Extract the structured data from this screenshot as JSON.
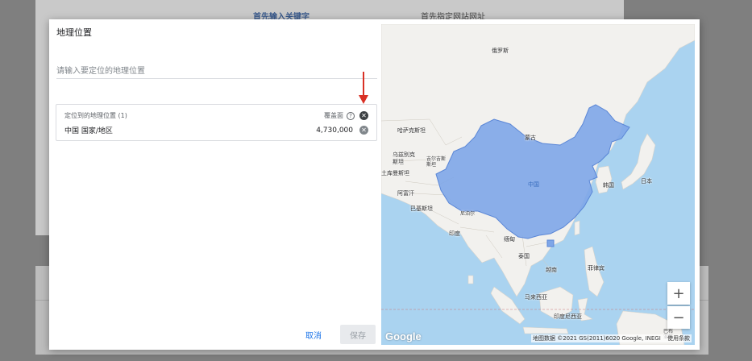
{
  "background": {
    "tab_keywords": "首先输入关键字",
    "tab_website": "首先指定网站网址"
  },
  "dialog": {
    "title": "地理位置",
    "search_placeholder": "请输入要定位的地理位置",
    "targeted_header": "定位到的地理位置 (1)",
    "reach_label": "覆盖面",
    "location_name": "中国 国家/地区",
    "location_reach": "4,730,000",
    "cancel_label": "取消",
    "save_label": "保存"
  },
  "map": {
    "labels": {
      "russia": "俄罗斯",
      "kazakhstan": "哈萨克斯坦",
      "mongolia": "蒙古",
      "uzbekistan": "乌兹别克\n斯坦",
      "kyrgyzstan": "吉尔吉斯\n斯坦",
      "turkmenistan": "土库曼斯坦",
      "afghanistan": "阿富汗",
      "pakistan": "巴基斯坦",
      "nepal": "尼泊尔",
      "india": "印度",
      "china": "中国",
      "korea": "韩国",
      "japan": "日本",
      "myanmar": "缅甸",
      "thailand": "泰国",
      "vietnam": "越南",
      "philippines": "菲律宾",
      "malaysia": "马来西亚",
      "indonesia": "印度尼西亚",
      "png": "巴布\n亚新"
    },
    "zoom_in": "+",
    "zoom_out": "−",
    "google": "Google",
    "attribution": "地图数据 ©2021 GS(2011)6020 Google, INEGI",
    "terms": "使用条款"
  },
  "colors": {
    "selection": "#7ea6e8",
    "water": "#aad3f0",
    "land": "#f2f1ee",
    "accent": "#1a73e8",
    "arrow": "#d93025"
  }
}
